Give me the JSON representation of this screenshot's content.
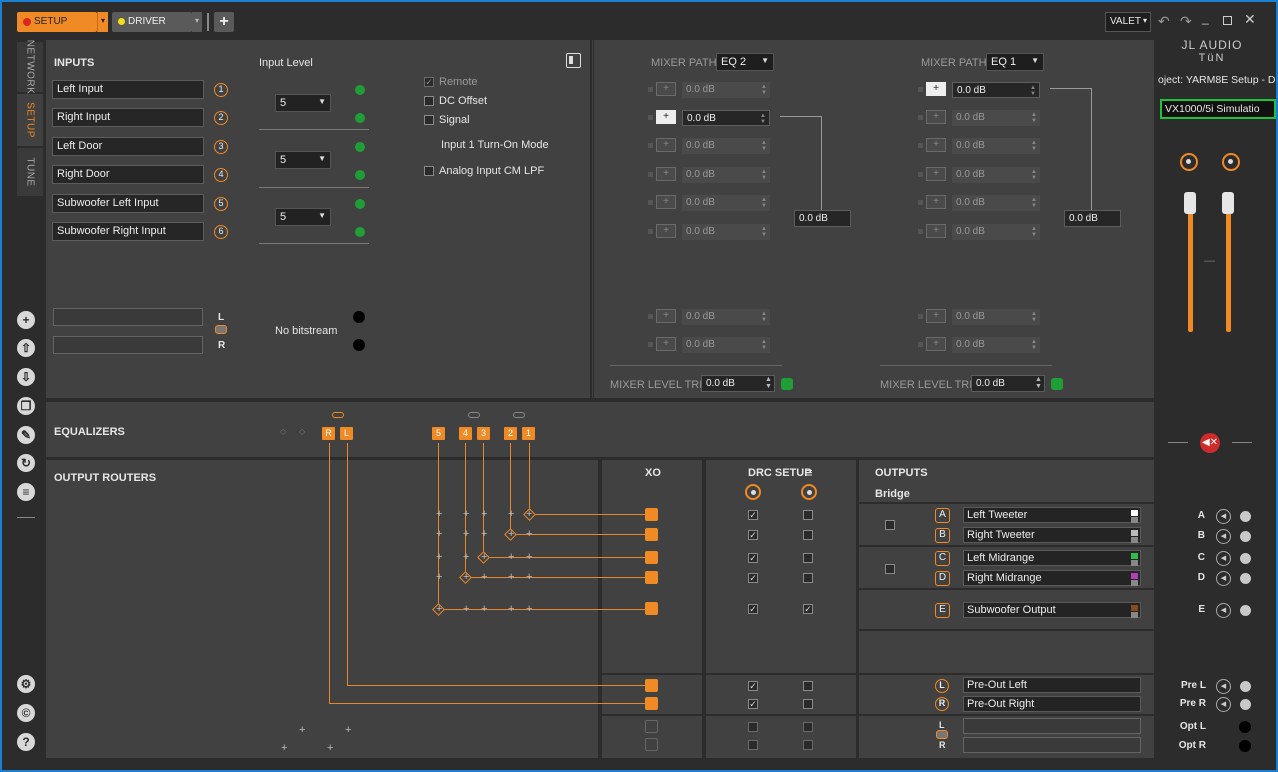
{
  "titlebar": {
    "setup_label": "SETUP",
    "driver_label": "DRIVER",
    "add_label": "+",
    "valet_label": "VALET",
    "colors": {
      "accent": "#f08a24",
      "setup_dot": "#d8261f",
      "driver_dot": "#f2e014"
    }
  },
  "nav": {
    "tabs": [
      "NETWORK",
      "SETUP",
      "TUNE"
    ],
    "active": "SETUP",
    "bottom_icons": [
      "add-icon",
      "upload-icon",
      "download-icon",
      "copy-icon",
      "wrench-icon",
      "refresh-icon",
      "list-icon",
      "gear-icon",
      "copyright-icon",
      "help-icon"
    ]
  },
  "inputs": {
    "title": "INPUTS",
    "input_level_label": "Input Level",
    "channels": [
      {
        "name": "Left Input",
        "num": "1"
      },
      {
        "name": "Right Input",
        "num": "2"
      },
      {
        "name": "Left Door",
        "num": "3"
      },
      {
        "name": "Right Door",
        "num": "4"
      },
      {
        "name": "Subwoofer Left Input",
        "num": "5"
      },
      {
        "name": "Subwoofer Right Input",
        "num": "6"
      }
    ],
    "levels": [
      "5",
      "5",
      "5"
    ],
    "options": {
      "remote": "Remote",
      "dc_offset": "DC Offset",
      "signal": "Signal",
      "turn_on_mode": "Input 1 Turn-On Mode",
      "analog_lpf": "Analog Input CM LPF"
    },
    "lr_l": "L",
    "lr_r": "R",
    "no_bitstream": "No bitstream"
  },
  "mixer": [
    {
      "path_label": "MIXER PATH",
      "eq": "EQ 2",
      "active_row": 1,
      "values": [
        "0.0 dB",
        "0.0 dB",
        "0.0 dB",
        "0.0 dB",
        "0.0 dB",
        "0.0 dB",
        "0.0 dB",
        "0.0 dB"
      ],
      "output": "0.0 dB",
      "trim_label": "MIXER LEVEL TRIM",
      "trim": "0.0 dB"
    },
    {
      "path_label": "MIXER PATH",
      "eq": "EQ 1",
      "active_row": 0,
      "values": [
        "0.0 dB",
        "0.0 dB",
        "0.0 dB",
        "0.0 dB",
        "0.0 dB",
        "0.0 dB",
        "0.0 dB",
        "0.0 dB"
      ],
      "output": "0.0 dB",
      "trim_label": "MIXER LEVEL TRIM",
      "trim": "0.0 dB"
    }
  ],
  "right_panel": {
    "brand": "JL AUDIO",
    "brand_sub": "TüN",
    "project": "oject: YARM8E Setup - D",
    "device": "VX1000/5i Simulatio",
    "fader_mid": "—"
  },
  "equalizers": {
    "title": "EQUALIZERS",
    "bands": [
      "R",
      "L",
      "5",
      "4",
      "3",
      "2",
      "1"
    ]
  },
  "routers": {
    "title": "OUTPUT ROUTERS",
    "xo_label": "XO",
    "drc_label": "DRC SETUP",
    "drc_menu": "≡",
    "drc_rows": [
      [
        true,
        false
      ],
      [
        true,
        false
      ],
      [
        true,
        false
      ],
      [
        true,
        false
      ],
      [
        true,
        true
      ],
      [
        true,
        false
      ],
      [
        true,
        false
      ],
      [
        false,
        false
      ],
      [
        false,
        false
      ]
    ]
  },
  "outputs": {
    "title": "OUTPUTS",
    "bridge_label": "Bridge",
    "channels": [
      {
        "letter": "A",
        "name": "Left Tweeter",
        "color": "#ffffff"
      },
      {
        "letter": "B",
        "name": "Right Tweeter",
        "color": "#bbbbbb"
      },
      {
        "letter": "C",
        "name": "Left Midrange",
        "color": "#2dbf4a"
      },
      {
        "letter": "D",
        "name": "Right Midrange",
        "color": "#b23fb8"
      },
      {
        "letter": "E",
        "name": "Subwoofer Output",
        "color": "#8a4b1c"
      }
    ],
    "preouts": [
      {
        "letter": "L",
        "name": "Pre-Out Left"
      },
      {
        "letter": "R",
        "name": "Pre-Out Right"
      }
    ],
    "opt_l": "L",
    "opt_r": "R"
  },
  "side_outputs": [
    {
      "label": "A"
    },
    {
      "label": "B"
    },
    {
      "label": "C"
    },
    {
      "label": "D"
    },
    {
      "label": "E"
    },
    {
      "label": "Pre L"
    },
    {
      "label": "Pre R"
    },
    {
      "label": "Opt L"
    },
    {
      "label": "Opt R"
    }
  ]
}
